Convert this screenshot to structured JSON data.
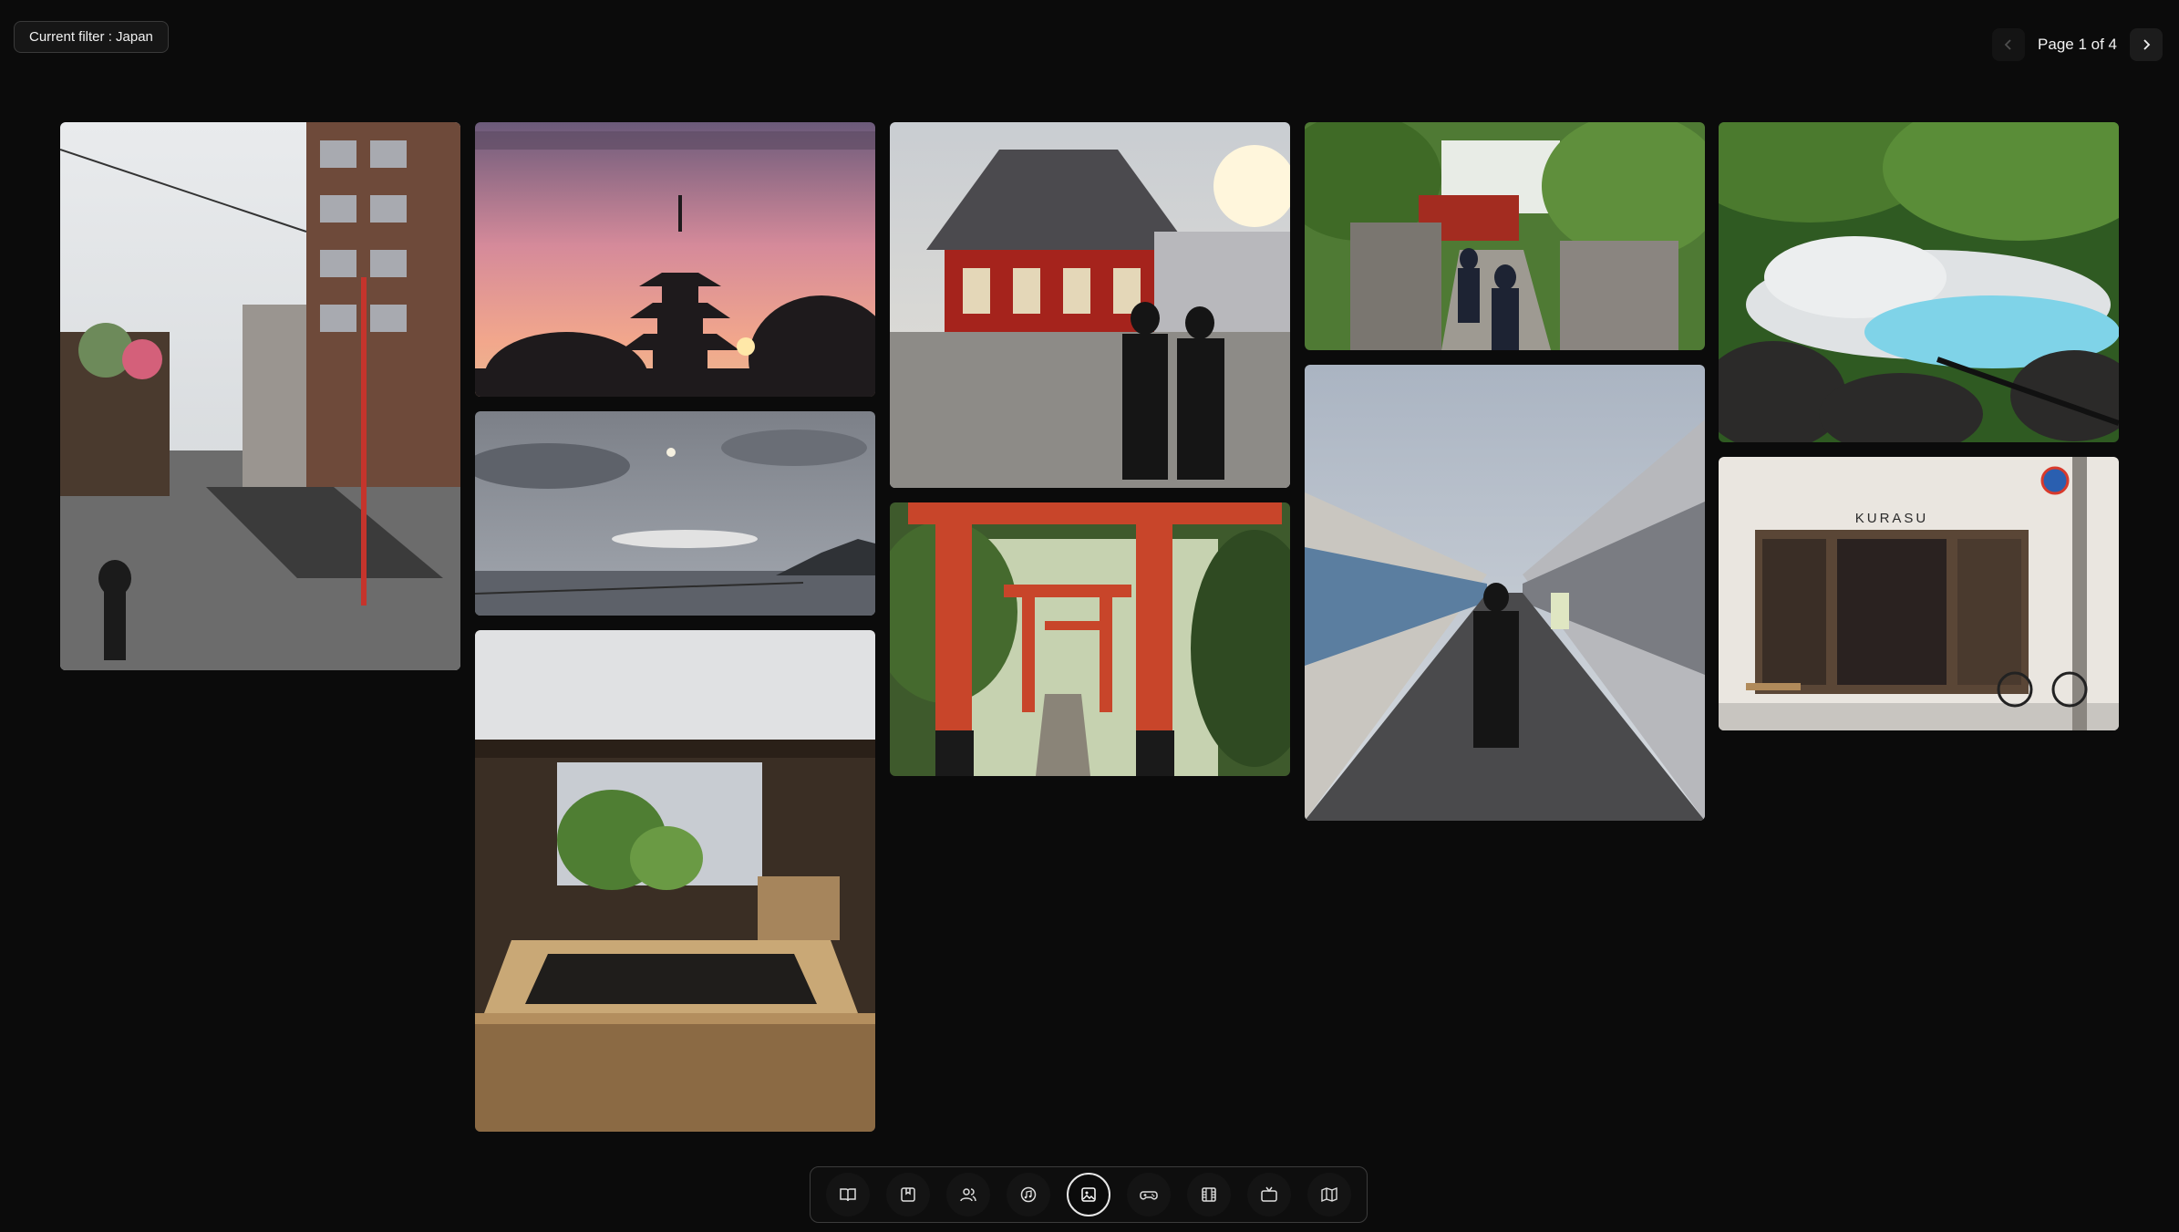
{
  "filter": {
    "label": "Current filter : Japan"
  },
  "pagination": {
    "label": "Page 1 of 4",
    "current": 1,
    "total": 4
  },
  "photos": [
    {
      "name": "street-walk",
      "scene": "asakusa street at dawn"
    },
    {
      "name": "pagoda-sunset",
      "scene": "pagoda silhouette at sunset"
    },
    {
      "name": "sea-moon",
      "scene": "sea and moon dusk"
    },
    {
      "name": "onsen-bath",
      "scene": "wooden hot spring bath"
    },
    {
      "name": "temple-two-men",
      "scene": "senso-ji temple with two men"
    },
    {
      "name": "torii-gates",
      "scene": "red torii gates"
    },
    {
      "name": "shrine-stairs",
      "scene": "shrine stairs with greenery"
    },
    {
      "name": "shopping-arcade",
      "scene": "closed shopping street"
    },
    {
      "name": "blue-hot-spring",
      "scene": "blue steaming hot spring"
    },
    {
      "name": "kurasu-shop",
      "scene": "kurasu storefront"
    }
  ],
  "kurasu_sign": "KURASU",
  "dock": [
    {
      "name": "books-icon",
      "active": false
    },
    {
      "name": "bookmark-icon",
      "active": false
    },
    {
      "name": "people-icon",
      "active": false
    },
    {
      "name": "music-icon",
      "active": false
    },
    {
      "name": "image-icon",
      "active": true
    },
    {
      "name": "gamepad-icon",
      "active": false
    },
    {
      "name": "film-icon",
      "active": false
    },
    {
      "name": "tv-icon",
      "active": false
    },
    {
      "name": "map-icon",
      "active": false
    }
  ],
  "colors": {
    "background": "#0b0b0b",
    "torii_red": "#c8452a",
    "spring_blue": "#7fd3e8"
  }
}
